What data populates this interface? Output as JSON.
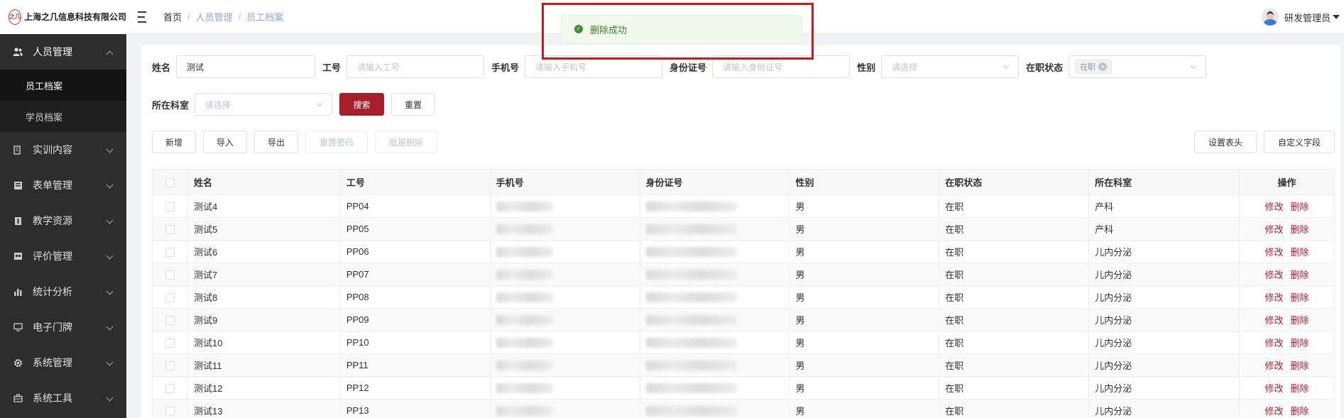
{
  "brand": {
    "logo_text": "之几",
    "name": "上海之几信息科技有限公司"
  },
  "breadcrumb": [
    "首页",
    "人员管理",
    "员工档案"
  ],
  "user": {
    "name": "研发管理员"
  },
  "toast": {
    "message": "删除成功"
  },
  "sidebar": {
    "items": [
      {
        "label": "人员管理",
        "icon": "users-icon",
        "open": true,
        "children": [
          {
            "label": "员工档案",
            "active": true
          },
          {
            "label": "学员档案",
            "active": false
          }
        ]
      },
      {
        "label": "实训内容",
        "icon": "book-icon"
      },
      {
        "label": "表单管理",
        "icon": "form-icon"
      },
      {
        "label": "教学资源",
        "icon": "resource-icon"
      },
      {
        "label": "评价管理",
        "icon": "evaluation-icon"
      },
      {
        "label": "统计分析",
        "icon": "bar-chart-icon"
      },
      {
        "label": "电子门牌",
        "icon": "monitor-icon"
      },
      {
        "label": "系统管理",
        "icon": "gear-icon"
      },
      {
        "label": "系统工具",
        "icon": "toolbox-icon"
      }
    ]
  },
  "filters": {
    "name": {
      "label": "姓名",
      "value": "测试"
    },
    "job_no": {
      "label": "工号",
      "placeholder": "请输入工号"
    },
    "phone": {
      "label": "手机号",
      "placeholder": "请输入手机号"
    },
    "id_card": {
      "label": "身份证号",
      "placeholder": "请输入身份证号"
    },
    "gender": {
      "label": "性别",
      "placeholder": "请选择"
    },
    "status": {
      "label": "在职状态",
      "tag": "在职"
    },
    "department": {
      "label": "所在科室",
      "placeholder": "请选择"
    },
    "search_label": "搜索",
    "reset_label": "重置"
  },
  "toolbar": {
    "add": "新增",
    "import": "导入",
    "export": "导出",
    "reset_password": "重置密码",
    "batch_delete": "批量删除",
    "set_header": "设置表头",
    "custom_fields": "自定义字段"
  },
  "table": {
    "columns": [
      "姓名",
      "工号",
      "手机号",
      "身份证号",
      "性别",
      "在职状态",
      "所在科室",
      "操作"
    ],
    "action_edit": "修改",
    "action_delete": "删除",
    "rows": [
      {
        "name": "测试4",
        "job_no": "PP04",
        "gender": "男",
        "status": "在职",
        "department": "产科"
      },
      {
        "name": "测试5",
        "job_no": "PP05",
        "gender": "男",
        "status": "在职",
        "department": "产科"
      },
      {
        "name": "测试6",
        "job_no": "PP06",
        "gender": "男",
        "status": "在职",
        "department": "儿内分泌"
      },
      {
        "name": "测试7",
        "job_no": "PP07",
        "gender": "男",
        "status": "在职",
        "department": "儿内分泌"
      },
      {
        "name": "测试8",
        "job_no": "PP08",
        "gender": "男",
        "status": "在职",
        "department": "儿内分泌"
      },
      {
        "name": "测试9",
        "job_no": "PP09",
        "gender": "男",
        "status": "在职",
        "department": "儿内分泌"
      },
      {
        "name": "测试10",
        "job_no": "PP10",
        "gender": "男",
        "status": "在职",
        "department": "儿内分泌"
      },
      {
        "name": "测试11",
        "job_no": "PP11",
        "gender": "男",
        "status": "在职",
        "department": "儿内分泌"
      },
      {
        "name": "测试12",
        "job_no": "PP12",
        "gender": "男",
        "status": "在职",
        "department": "儿内分泌"
      },
      {
        "name": "测试13",
        "job_no": "PP13",
        "gender": "男",
        "status": "在职",
        "department": "儿内分泌"
      }
    ]
  }
}
